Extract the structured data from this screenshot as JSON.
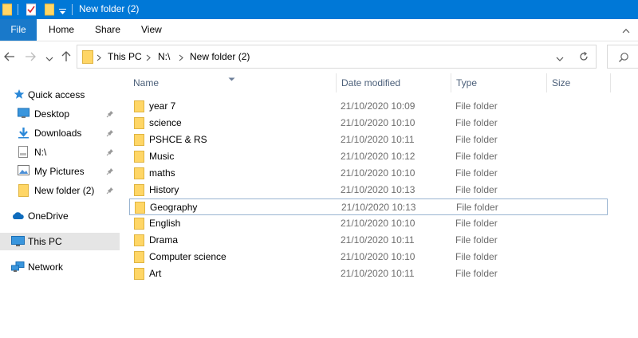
{
  "window": {
    "title": "New folder (2)"
  },
  "ribbon": {
    "tabs": [
      "File",
      "Home",
      "Share",
      "View"
    ]
  },
  "address": {
    "crumbs": [
      "This PC",
      "N:\\",
      "New folder (2)"
    ]
  },
  "nav": {
    "items": [
      {
        "label": "Quick access",
        "icon": "star-icon",
        "pinned": false,
        "selected": false
      },
      {
        "label": "Desktop",
        "icon": "desktop-icon",
        "pinned": true,
        "selected": false
      },
      {
        "label": "Downloads",
        "icon": "download-icon",
        "pinned": true,
        "selected": false
      },
      {
        "label": "N:\\",
        "icon": "drive-icon",
        "pinned": true,
        "selected": false
      },
      {
        "label": "My Pictures",
        "icon": "pictures-icon",
        "pinned": true,
        "selected": false
      },
      {
        "label": "New folder (2)",
        "icon": "folder-icon",
        "pinned": true,
        "selected": false
      },
      {
        "label": "OneDrive",
        "icon": "cloud-icon",
        "pinned": false,
        "selected": false
      },
      {
        "label": "This PC",
        "icon": "computer-icon",
        "pinned": false,
        "selected": true
      },
      {
        "label": "Network",
        "icon": "network-icon",
        "pinned": false,
        "selected": false
      }
    ]
  },
  "columns": {
    "name": "Name",
    "date": "Date modified",
    "type": "Type",
    "size": "Size"
  },
  "files": [
    {
      "name": "year 7",
      "date": "21/10/2020 10:09",
      "type": "File folder"
    },
    {
      "name": "science",
      "date": "21/10/2020 10:10",
      "type": "File folder"
    },
    {
      "name": "PSHCE & RS",
      "date": "21/10/2020 10:11",
      "type": "File folder"
    },
    {
      "name": "Music",
      "date": "21/10/2020 10:12",
      "type": "File folder"
    },
    {
      "name": "maths",
      "date": "21/10/2020 10:10",
      "type": "File folder"
    },
    {
      "name": "History",
      "date": "21/10/2020 10:13",
      "type": "File folder"
    },
    {
      "name": "Geography",
      "date": "21/10/2020 10:13",
      "type": "File folder"
    },
    {
      "name": "English",
      "date": "21/10/2020 10:10",
      "type": "File folder"
    },
    {
      "name": "Drama",
      "date": "21/10/2020 10:11",
      "type": "File folder"
    },
    {
      "name": "Computer science",
      "date": "21/10/2020 10:10",
      "type": "File folder"
    },
    {
      "name": "Art",
      "date": "21/10/2020 10:11",
      "type": "File folder"
    }
  ],
  "focused_file": "Geography",
  "colors": {
    "titlebar": "#0078d7",
    "file_tab": "#1979ca",
    "folder": "#ffd666",
    "header_text": "#4c607a"
  }
}
